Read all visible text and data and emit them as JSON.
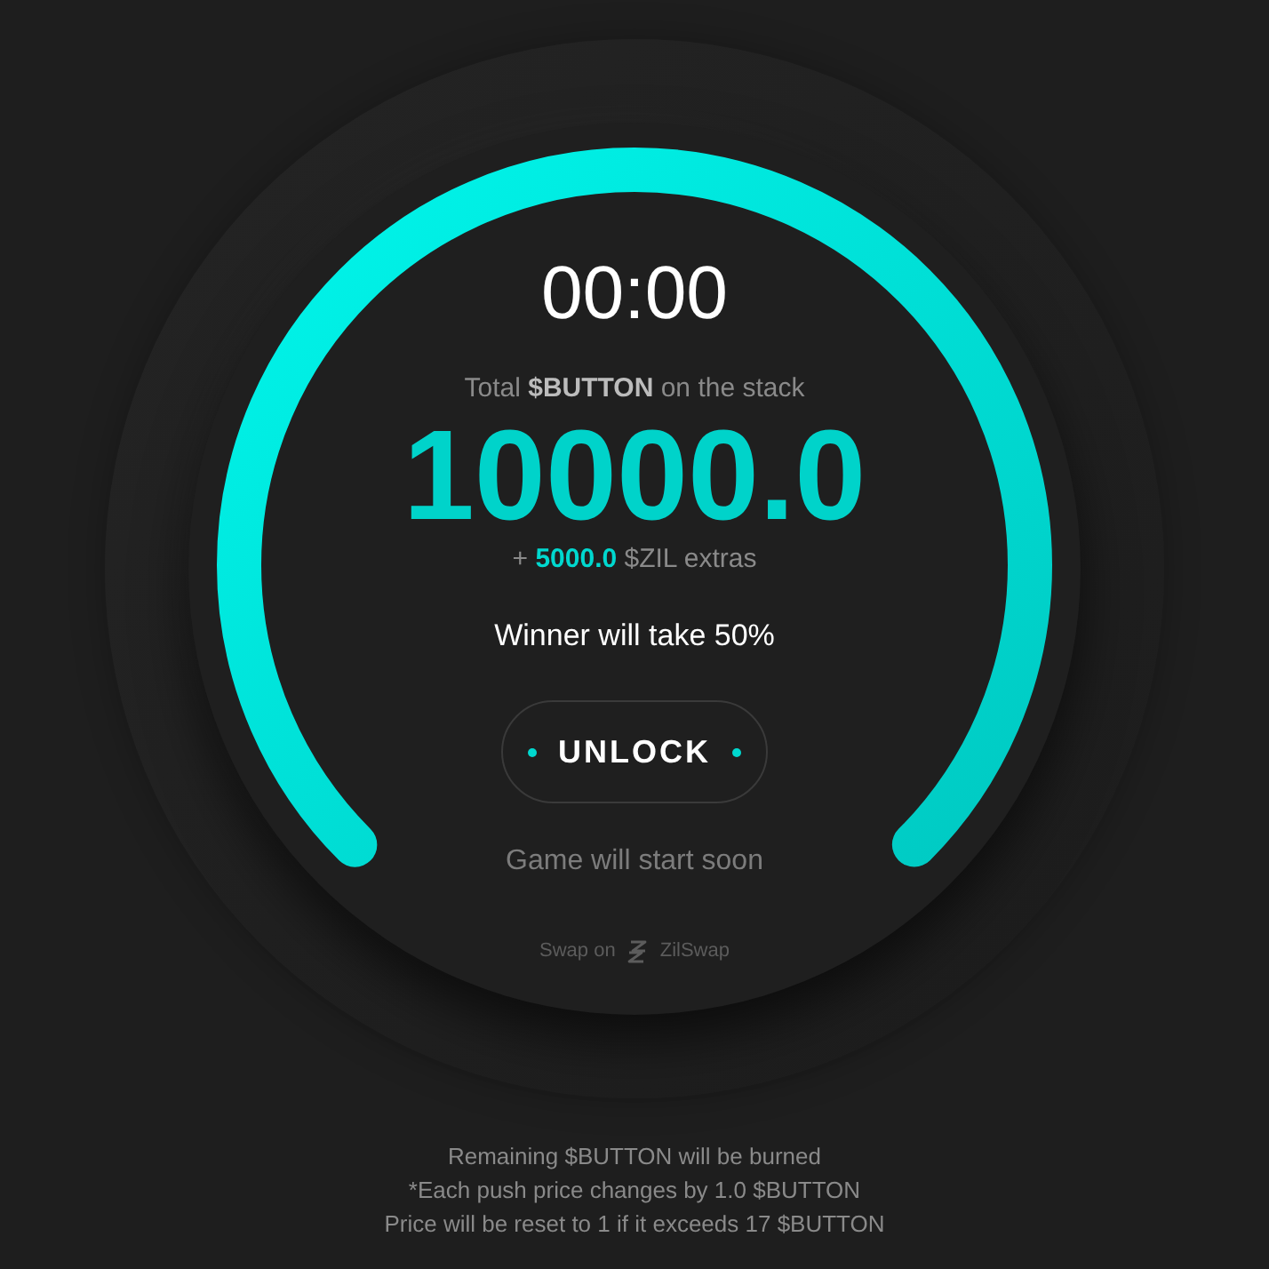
{
  "gauge": {
    "level": 1
  },
  "timer": "00:00",
  "stack": {
    "label": "Total **$BUTTON** on the stack",
    "amount": "10000.0",
    "extras": "+ **5000.0** $ZIL extras"
  },
  "winner_text": "Winner will take 50%",
  "unlock_button": {
    "label": "UNLOCK"
  },
  "status": "Game will start soon",
  "swap_link": {
    "prefix": "Swap on",
    "name": "ZilSwap"
  },
  "footer": [
    "Remaining $BUTTON will be burned",
    "*Each push price changes by 1.0 $BUTTON",
    "Price will be reset to 1 if it exceeds 17 $BUTTON"
  ]
}
